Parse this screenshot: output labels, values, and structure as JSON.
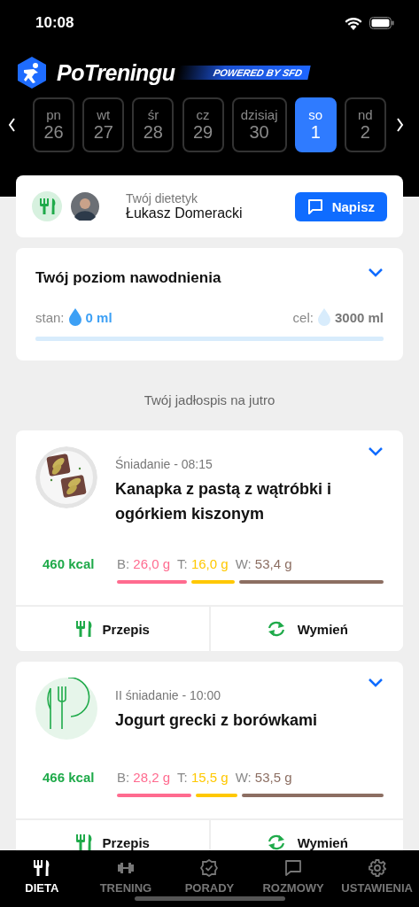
{
  "status_bar": {
    "time": "10:08"
  },
  "header": {
    "app_name": "PoTreningu",
    "badge": "POWERED BY SFD"
  },
  "days": [
    {
      "weekday": "pn",
      "date": "26",
      "selected": false
    },
    {
      "weekday": "wt",
      "date": "27",
      "selected": false
    },
    {
      "weekday": "śr",
      "date": "28",
      "selected": false
    },
    {
      "weekday": "cz",
      "date": "29",
      "selected": false
    },
    {
      "weekday": "dzisiaj",
      "date": "30",
      "selected": false
    },
    {
      "weekday": "so",
      "date": "1",
      "selected": true
    },
    {
      "weekday": "nd",
      "date": "2",
      "selected": false
    }
  ],
  "dietitian": {
    "label": "Twój dietetyk",
    "name": "Łukasz Domeracki",
    "button": "Napisz"
  },
  "hydration": {
    "title": "Twój poziom nawodnienia",
    "current_label": "stan:",
    "current": "0 ml",
    "goal_label": "cel:",
    "goal": "3000 ml",
    "level": 0
  },
  "section_title": "Twój jadłospis na jutro",
  "meals": [
    {
      "kind": "picture",
      "meal": "Śniadanie - 08:15",
      "name": "Kanapka z pastą z wątróbki i ogórkiem kiszonym",
      "kcal": "460 kcal",
      "macros": [
        {
          "label": "B:",
          "value": "26,0 g",
          "color": "#ff6b8f"
        },
        {
          "label": "T:",
          "value": "16,0 g",
          "color": "#ffc800"
        },
        {
          "label": "W:",
          "value": "53,4 g",
          "color": "#8c6e62"
        }
      ],
      "actions": [
        "Przepis",
        "Wymień"
      ]
    },
    {
      "kind": "placeholder",
      "meal": "II śniadanie - 10:00",
      "name": "Jogurt grecki z borówkami",
      "kcal": "466 kcal",
      "macros": [
        {
          "label": "B:",
          "value": "28,2 g",
          "color": "#ff6b8f"
        },
        {
          "label": "T:",
          "value": "15,5 g",
          "color": "#ffc800"
        },
        {
          "label": "W:",
          "value": "53,5 g",
          "color": "#8c6e62"
        }
      ],
      "actions": [
        "Przepis",
        "Wymień"
      ]
    }
  ],
  "tab_bar": [
    {
      "label": "DIETA",
      "selected": true
    },
    {
      "label": "TRENING",
      "selected": false
    },
    {
      "label": "PORADY",
      "selected": false
    },
    {
      "label": "ROZMOWY",
      "selected": false
    },
    {
      "label": "USTAWIENIA",
      "selected": false
    }
  ]
}
